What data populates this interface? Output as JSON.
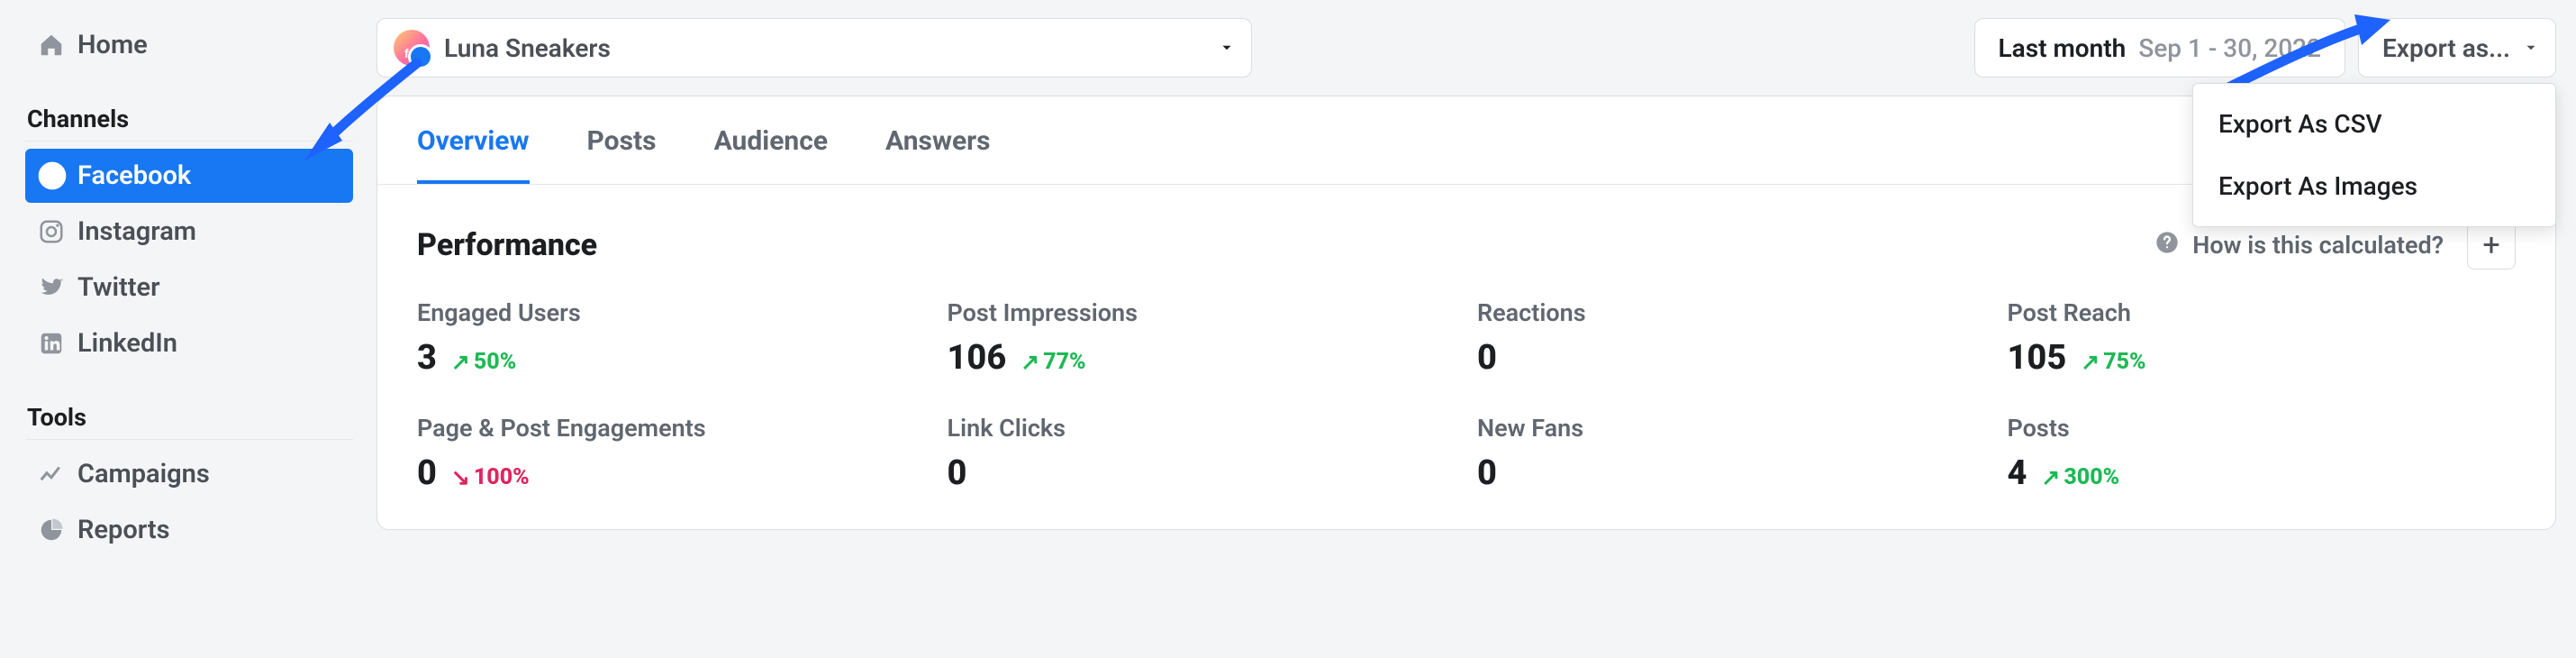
{
  "sidebar": {
    "home": "Home",
    "section_channels": "Channels",
    "channels": [
      {
        "label": "Facebook",
        "icon": "facebook",
        "active": true
      },
      {
        "label": "Instagram",
        "icon": "instagram",
        "active": false
      },
      {
        "label": "Twitter",
        "icon": "twitter",
        "active": false
      },
      {
        "label": "LinkedIn",
        "icon": "linkedin",
        "active": false
      }
    ],
    "section_tools": "Tools",
    "tools": [
      {
        "label": "Campaigns",
        "icon": "trend"
      },
      {
        "label": "Reports",
        "icon": "pie"
      }
    ]
  },
  "header": {
    "account_name": "Luna Sneakers",
    "date_label": "Last month",
    "date_range": "Sep 1 - 30, 2022",
    "export_label": "Export as...",
    "export_menu": [
      "Export As CSV",
      "Export As Images"
    ]
  },
  "tabs": [
    "Overview",
    "Posts",
    "Audience",
    "Answers"
  ],
  "active_tab": 0,
  "performance": {
    "title": "Performance",
    "how_calc": "How is this calculated?",
    "metrics": [
      {
        "label": "Engaged Users",
        "value": "3",
        "delta": "50%",
        "dir": "up"
      },
      {
        "label": "Post Impressions",
        "value": "106",
        "delta": "77%",
        "dir": "up"
      },
      {
        "label": "Reactions",
        "value": "0",
        "delta": "",
        "dir": ""
      },
      {
        "label": "Post Reach",
        "value": "105",
        "delta": "75%",
        "dir": "up"
      },
      {
        "label": "Page & Post Engagements",
        "value": "0",
        "delta": "100%",
        "dir": "down"
      },
      {
        "label": "Link Clicks",
        "value": "0",
        "delta": "",
        "dir": ""
      },
      {
        "label": "New Fans",
        "value": "0",
        "delta": "",
        "dir": ""
      },
      {
        "label": "Posts",
        "value": "4",
        "delta": "300%",
        "dir": "up"
      }
    ]
  }
}
